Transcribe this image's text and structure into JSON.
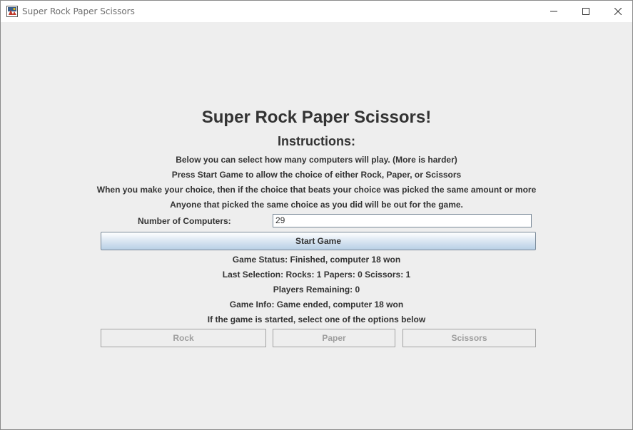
{
  "window": {
    "title": "Super Rock Paper Scissors",
    "icon": "java-app-icon",
    "controls": [
      "minimize-icon",
      "maximize-icon",
      "close-icon"
    ]
  },
  "main": {
    "title": "Super Rock Paper Scissors!",
    "instructions_heading": "Instructions:",
    "instructions": [
      "Below you can select how many computers will play. (More is harder)",
      "Press Start Game to allow the choice of either Rock, Paper, or Scissors",
      "When you make your choice, then if the choice that beats your choice was picked the same amount or more",
      "Anyone that picked the same choice as you did will be out for the game."
    ],
    "num_computers_label": "Number of Computers:",
    "num_computers_value": "29",
    "start_button_label": "Start Game",
    "status_lines": [
      "Game Status: Finished, computer 18 won",
      "Last Selection: Rocks: 1 Papers: 0 Scissors: 1",
      "Players Remaining: 0",
      "Game Info: Game ended, computer 18 won",
      "If the game is started, select one of the options below"
    ],
    "choices": {
      "rock": "Rock",
      "paper": "Paper",
      "scissors": "Scissors"
    }
  },
  "colors": {
    "background": "#eeeeee",
    "text": "#333333",
    "disabled_text": "#9e9e9e",
    "button_gradient_bottom": "#b8cfe5"
  }
}
